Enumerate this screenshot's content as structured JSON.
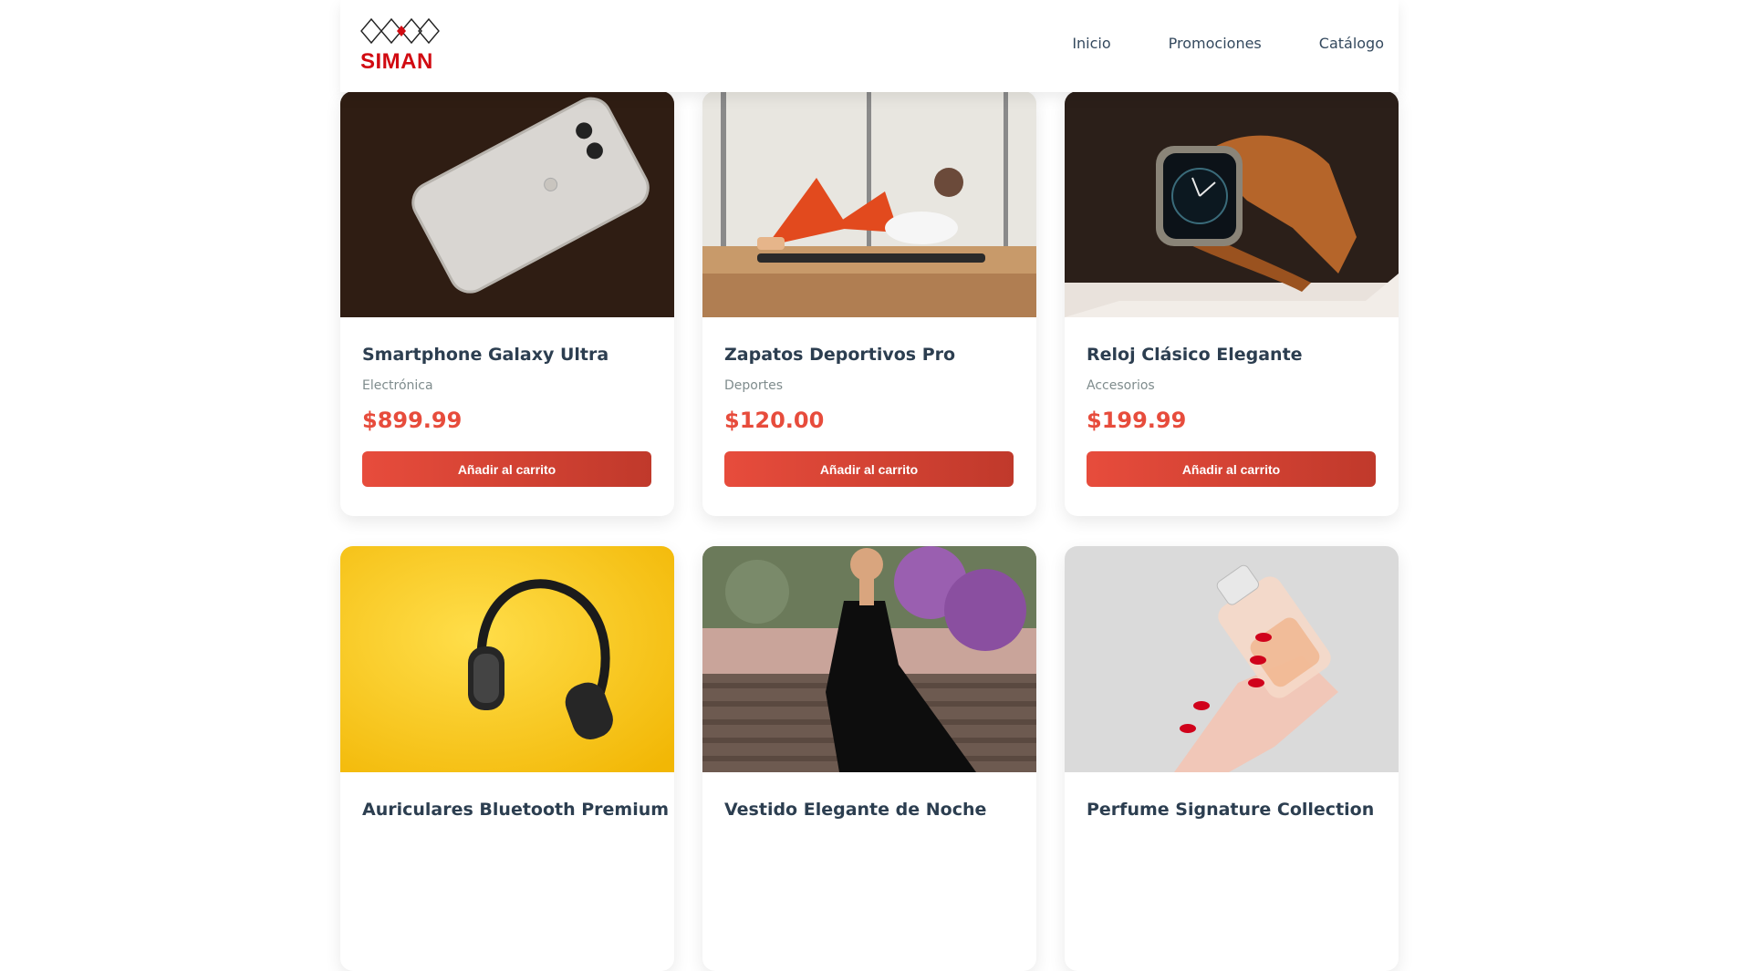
{
  "brand": {
    "name": "SIMAN",
    "color": "#d10a11"
  },
  "nav": {
    "items": [
      "Inicio",
      "Promociones",
      "Catálogo"
    ]
  },
  "accent": "#e74c3c",
  "products": [
    {
      "title": "Smartphone Galaxy Ultra",
      "category": "Electrónica",
      "price": "$899.99",
      "button": "Añadir al carrito",
      "image": "white-smartphone-photo"
    },
    {
      "title": "Zapatos Deportivos Pro",
      "category": "Deportes",
      "price": "$120.00",
      "button": "Añadir al carrito",
      "image": "woman-exercising-photo"
    },
    {
      "title": "Reloj Clásico Elegante",
      "category": "Accesorios",
      "price": "$199.99",
      "button": "Añadir al carrito",
      "image": "smartwatch-photo"
    },
    {
      "title": "Auriculares Bluetooth Premium",
      "image": "headphones-photo"
    },
    {
      "title": "Vestido Elegante de Noche",
      "image": "black-dress-photo"
    },
    {
      "title": "Perfume Signature Collection",
      "image": "perfume-photo"
    }
  ]
}
